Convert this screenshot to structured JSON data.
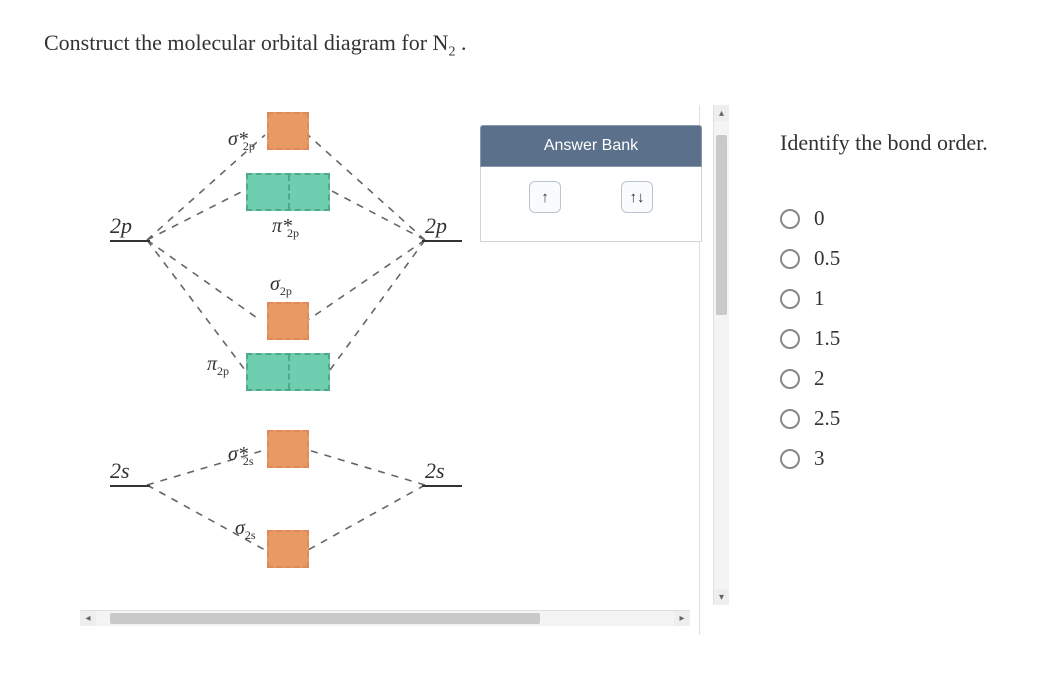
{
  "question_html": "Construct the molecular orbital diagram for N<sub>2</sub> .",
  "diagram": {
    "atomic_left": {
      "p": "2p",
      "s": "2s"
    },
    "atomic_right": {
      "p": "2p",
      "s": "2s"
    },
    "mo_labels": {
      "sigma2p_star": "σ*<sub style='margin-left:-5px'>2p</sub>",
      "pi2p_star": "π*<sub style='margin-left:-5px'>2p</sub>",
      "sigma2p": "σ<sub>2p</sub>",
      "pi2p": "π<sub>2p</sub>",
      "sigma2s_star": "σ*<sub style='margin-left:-5px'>2s</sub>",
      "sigma2s": "σ<sub>2s</sub>"
    }
  },
  "answer_bank": {
    "title": "Answer Bank",
    "chips": [
      "↑",
      "↑↓"
    ]
  },
  "bond_order": {
    "prompt": "Identify the bond order.",
    "options": [
      "0",
      "0.5",
      "1",
      "1.5",
      "2",
      "2.5",
      "3"
    ]
  }
}
